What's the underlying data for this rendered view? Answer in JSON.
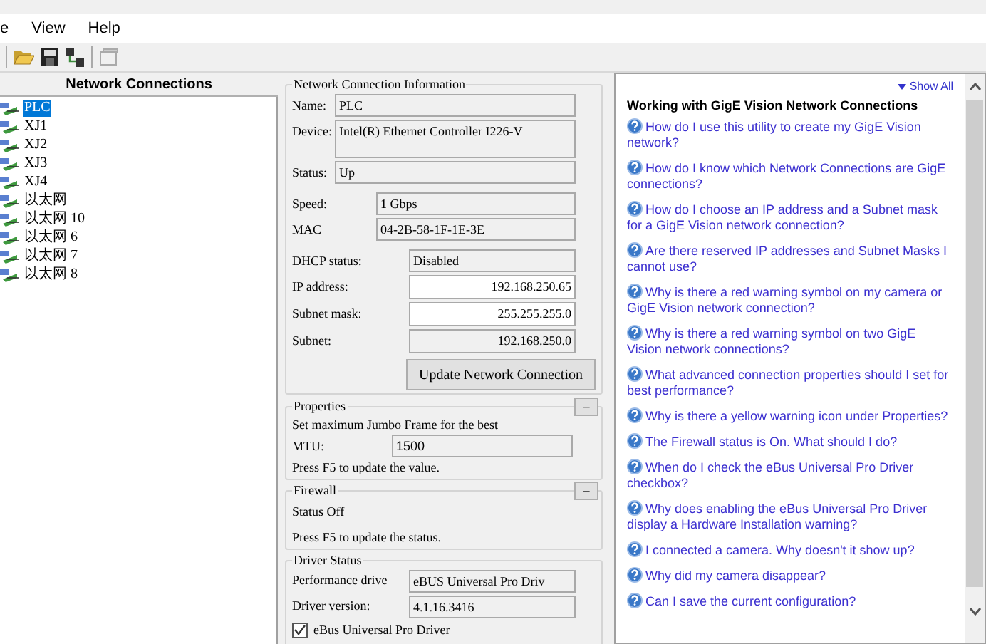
{
  "menu": [
    {
      "label": "e"
    },
    {
      "label": "View"
    },
    {
      "label": "Help"
    }
  ],
  "connections": {
    "header": "Network Connections",
    "items": [
      {
        "label": "PLC",
        "selected": true
      },
      {
        "label": "XJ1",
        "selected": false
      },
      {
        "label": "XJ2",
        "selected": false
      },
      {
        "label": "XJ3",
        "selected": false
      },
      {
        "label": "XJ4",
        "selected": false
      },
      {
        "label": "以太网",
        "selected": false
      },
      {
        "label": "以太网 10",
        "selected": false
      },
      {
        "label": "以太网 6",
        "selected": false
      },
      {
        "label": "以太网 7",
        "selected": false
      },
      {
        "label": "以太网 8",
        "selected": false
      }
    ]
  },
  "info": {
    "title": "Network Connection Information",
    "fields": [
      {
        "label": "Name:",
        "value": "PLC",
        "kind": "top"
      },
      {
        "label": "Device:",
        "value": "Intel(R) Ethernet Controller I226-V",
        "kind": "top-tall"
      },
      {
        "label": "Status:",
        "value": "Up",
        "kind": "top"
      },
      {
        "label": "Speed:",
        "value": "1 Gbps",
        "kind": "mid"
      },
      {
        "label": "MAC",
        "value": "04-2B-58-1F-1E-3E",
        "kind": "mid"
      },
      {
        "label": "DHCP status:",
        "value": "Disabled",
        "kind": "low"
      },
      {
        "label": "IP address:",
        "value": "192.168.250.65",
        "kind": "edit"
      },
      {
        "label": "Subnet mask:",
        "value": "255.255.255.0",
        "kind": "edit"
      },
      {
        "label": "Subnet:",
        "value": "192.168.250.0",
        "kind": "low-right"
      }
    ],
    "button": "Update Network Connection"
  },
  "properties": {
    "title": "Properties",
    "collapse": "–",
    "text": "Set maximum Jumbo Frame for the best",
    "mtu_label": "MTU:",
    "mtu_value": "1500",
    "note": "Press F5 to update the value."
  },
  "firewall": {
    "title": "Firewall",
    "collapse": "–",
    "status": "Status Off",
    "note": "Press F5 to update the status."
  },
  "driver": {
    "title": "Driver Status",
    "fields": [
      {
        "label": "Performance drive",
        "value": "eBUS Universal Pro Driv"
      },
      {
        "label": "Driver version:",
        "value": "4.1.16.3416"
      }
    ],
    "checkbox": {
      "label": "eBus Universal Pro Driver",
      "checked": true
    }
  },
  "help": {
    "show_all": "Show All",
    "title": "Working with GigE Vision Network Connections",
    "links": [
      "How do I use this utility to create my GigE Vision network?",
      "How do I know which Network Connections are GigE connections?",
      "How do I choose an IP address and a Subnet mask for a GigE Vision network connection?",
      "Are there reserved IP addresses and Subnet Masks I cannot use?",
      "Why is there a red warning symbol on my camera or GigE Vision network connection?",
      "Why is there a red warning symbol on two GigE Vision network connections?",
      "What advanced connection properties should I set for best performance?",
      "Why is there a yellow warning icon under Properties?",
      "The Firewall status is On. What should I do?",
      "When do I check the eBus Universal Pro Driver checkbox?",
      "Why does enabling the eBus Universal Pro Driver display a Hardware Installation warning?",
      "I connected a camera. Why doesn't it show up?",
      "Why did my camera disappear?",
      "Can I save the current configuration?"
    ]
  }
}
